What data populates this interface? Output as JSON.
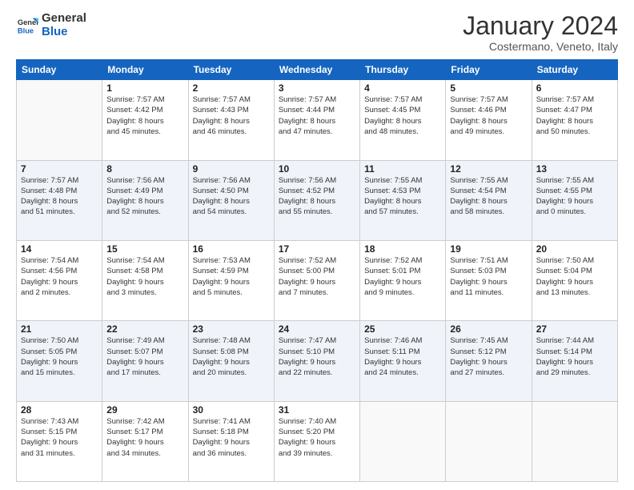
{
  "header": {
    "logo_general": "General",
    "logo_blue": "Blue",
    "title": "January 2024",
    "subtitle": "Costermano, Veneto, Italy"
  },
  "columns": [
    "Sunday",
    "Monday",
    "Tuesday",
    "Wednesday",
    "Thursday",
    "Friday",
    "Saturday"
  ],
  "weeks": [
    [
      {
        "num": "",
        "info": ""
      },
      {
        "num": "1",
        "info": "Sunrise: 7:57 AM\nSunset: 4:42 PM\nDaylight: 8 hours\nand 45 minutes."
      },
      {
        "num": "2",
        "info": "Sunrise: 7:57 AM\nSunset: 4:43 PM\nDaylight: 8 hours\nand 46 minutes."
      },
      {
        "num": "3",
        "info": "Sunrise: 7:57 AM\nSunset: 4:44 PM\nDaylight: 8 hours\nand 47 minutes."
      },
      {
        "num": "4",
        "info": "Sunrise: 7:57 AM\nSunset: 4:45 PM\nDaylight: 8 hours\nand 48 minutes."
      },
      {
        "num": "5",
        "info": "Sunrise: 7:57 AM\nSunset: 4:46 PM\nDaylight: 8 hours\nand 49 minutes."
      },
      {
        "num": "6",
        "info": "Sunrise: 7:57 AM\nSunset: 4:47 PM\nDaylight: 8 hours\nand 50 minutes."
      }
    ],
    [
      {
        "num": "7",
        "info": "Sunrise: 7:57 AM\nSunset: 4:48 PM\nDaylight: 8 hours\nand 51 minutes."
      },
      {
        "num": "8",
        "info": "Sunrise: 7:56 AM\nSunset: 4:49 PM\nDaylight: 8 hours\nand 52 minutes."
      },
      {
        "num": "9",
        "info": "Sunrise: 7:56 AM\nSunset: 4:50 PM\nDaylight: 8 hours\nand 54 minutes."
      },
      {
        "num": "10",
        "info": "Sunrise: 7:56 AM\nSunset: 4:52 PM\nDaylight: 8 hours\nand 55 minutes."
      },
      {
        "num": "11",
        "info": "Sunrise: 7:55 AM\nSunset: 4:53 PM\nDaylight: 8 hours\nand 57 minutes."
      },
      {
        "num": "12",
        "info": "Sunrise: 7:55 AM\nSunset: 4:54 PM\nDaylight: 8 hours\nand 58 minutes."
      },
      {
        "num": "13",
        "info": "Sunrise: 7:55 AM\nSunset: 4:55 PM\nDaylight: 9 hours\nand 0 minutes."
      }
    ],
    [
      {
        "num": "14",
        "info": "Sunrise: 7:54 AM\nSunset: 4:56 PM\nDaylight: 9 hours\nand 2 minutes."
      },
      {
        "num": "15",
        "info": "Sunrise: 7:54 AM\nSunset: 4:58 PM\nDaylight: 9 hours\nand 3 minutes."
      },
      {
        "num": "16",
        "info": "Sunrise: 7:53 AM\nSunset: 4:59 PM\nDaylight: 9 hours\nand 5 minutes."
      },
      {
        "num": "17",
        "info": "Sunrise: 7:52 AM\nSunset: 5:00 PM\nDaylight: 9 hours\nand 7 minutes."
      },
      {
        "num": "18",
        "info": "Sunrise: 7:52 AM\nSunset: 5:01 PM\nDaylight: 9 hours\nand 9 minutes."
      },
      {
        "num": "19",
        "info": "Sunrise: 7:51 AM\nSunset: 5:03 PM\nDaylight: 9 hours\nand 11 minutes."
      },
      {
        "num": "20",
        "info": "Sunrise: 7:50 AM\nSunset: 5:04 PM\nDaylight: 9 hours\nand 13 minutes."
      }
    ],
    [
      {
        "num": "21",
        "info": "Sunrise: 7:50 AM\nSunset: 5:05 PM\nDaylight: 9 hours\nand 15 minutes."
      },
      {
        "num": "22",
        "info": "Sunrise: 7:49 AM\nSunset: 5:07 PM\nDaylight: 9 hours\nand 17 minutes."
      },
      {
        "num": "23",
        "info": "Sunrise: 7:48 AM\nSunset: 5:08 PM\nDaylight: 9 hours\nand 20 minutes."
      },
      {
        "num": "24",
        "info": "Sunrise: 7:47 AM\nSunset: 5:10 PM\nDaylight: 9 hours\nand 22 minutes."
      },
      {
        "num": "25",
        "info": "Sunrise: 7:46 AM\nSunset: 5:11 PM\nDaylight: 9 hours\nand 24 minutes."
      },
      {
        "num": "26",
        "info": "Sunrise: 7:45 AM\nSunset: 5:12 PM\nDaylight: 9 hours\nand 27 minutes."
      },
      {
        "num": "27",
        "info": "Sunrise: 7:44 AM\nSunset: 5:14 PM\nDaylight: 9 hours\nand 29 minutes."
      }
    ],
    [
      {
        "num": "28",
        "info": "Sunrise: 7:43 AM\nSunset: 5:15 PM\nDaylight: 9 hours\nand 31 minutes."
      },
      {
        "num": "29",
        "info": "Sunrise: 7:42 AM\nSunset: 5:17 PM\nDaylight: 9 hours\nand 34 minutes."
      },
      {
        "num": "30",
        "info": "Sunrise: 7:41 AM\nSunset: 5:18 PM\nDaylight: 9 hours\nand 36 minutes."
      },
      {
        "num": "31",
        "info": "Sunrise: 7:40 AM\nSunset: 5:20 PM\nDaylight: 9 hours\nand 39 minutes."
      },
      {
        "num": "",
        "info": ""
      },
      {
        "num": "",
        "info": ""
      },
      {
        "num": "",
        "info": ""
      }
    ]
  ]
}
